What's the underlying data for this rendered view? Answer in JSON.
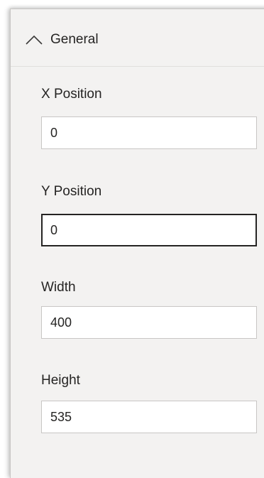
{
  "section": {
    "title": "General",
    "expanded": true,
    "icon": "chevron-up-icon"
  },
  "fields": {
    "x_position": {
      "label": "X Position",
      "value": "0"
    },
    "y_position": {
      "label": "Y Position",
      "value": "0",
      "focused": true
    },
    "width": {
      "label": "Width",
      "value": "400"
    },
    "height": {
      "label": "Height",
      "value": "535"
    }
  },
  "colors": {
    "panel_background": "#f3f2f1",
    "text": "#252423",
    "input_border": "#c8c6c4",
    "focused_border": "#252423"
  }
}
